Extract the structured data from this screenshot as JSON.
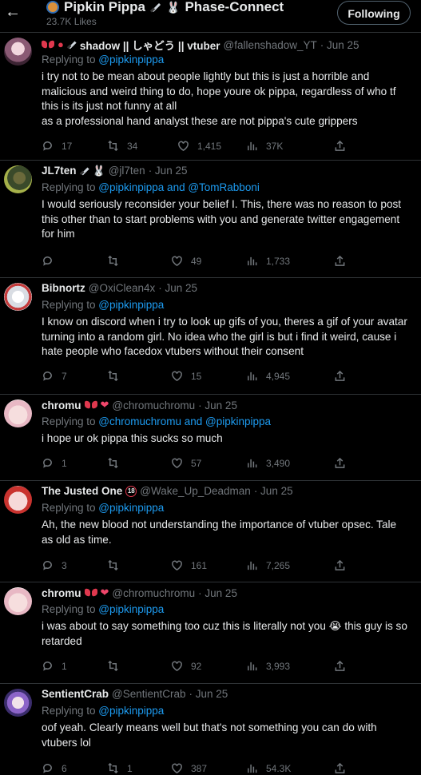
{
  "header": {
    "title": "Pipkin Pippa",
    "title_suffix": "Phase-Connect",
    "likes": "23.7K Likes",
    "follow_label": "Following"
  },
  "tweets": [
    {
      "name": "shadow || しゃどう || vtuber",
      "handle": "@fallenshadow_YT",
      "date": "· Jun 25",
      "reply_prefix": "Replying to ",
      "reply_to": "@pipkinpippa",
      "text": "i try not to be mean about people lightly but this is just a horrible and malicious and weird thing to do, hope youre ok pippa, regardless of who tf this is its just not funny at all\nas a professional hand analyst these are not pippa's cute grippers",
      "replies": "17",
      "retweets": "34",
      "likes": "1,415",
      "views": "37K"
    },
    {
      "name": "JL7ten",
      "handle": "@jl7ten",
      "date": "· Jun 25",
      "reply_prefix": "Replying to ",
      "reply_to": "@pipkinpippa and @TomRabboni",
      "text": "I would seriously reconsider your belief I. This, there was no reason to post this other than to start problems with you and generate twitter engagement for him",
      "replies": "",
      "retweets": "",
      "likes": "49",
      "views": "1,733"
    },
    {
      "name": "Bibnortz",
      "handle": "@OxiClean4x",
      "date": "· Jun 25",
      "reply_prefix": "Replying to ",
      "reply_to": "@pipkinpippa",
      "text": "I know on discord when i try to look up gifs of you, theres a gif of your avatar turning into a random girl. No idea who the girl is but i find it weird, cause i hate people who facedox vtubers without their consent",
      "replies": "7",
      "retweets": "",
      "likes": "15",
      "views": "4,945"
    },
    {
      "name": "chromu",
      "handle": "@chromuchromu",
      "date": "· Jun 25",
      "reply_prefix": "Replying to ",
      "reply_to": "@chromuchromu and @pipkinpippa",
      "text": "i hope ur ok pippa this sucks so much",
      "replies": "1",
      "retweets": "",
      "likes": "57",
      "views": "3,490"
    },
    {
      "name": "The Justed One",
      "handle": "@Wake_Up_Deadman",
      "date": "· Jun 25",
      "reply_prefix": "Replying to ",
      "reply_to": "@pipkinpippa",
      "text": "Ah, the new blood not understanding the importance of vtuber opsec. Tale as old as time.",
      "replies": "3",
      "retweets": "",
      "likes": "161",
      "views": "7,265"
    },
    {
      "name": "chromu",
      "handle": "@chromuchromu",
      "date": "· Jun 25",
      "reply_prefix": "Replying to ",
      "reply_to": "@pipkinpippa",
      "text": "i was about to say something too cuz this is literally not you 😭 this guy is so retarded",
      "replies": "1",
      "retweets": "",
      "likes": "92",
      "views": "3,993"
    },
    {
      "name": "SentientCrab",
      "handle": "@SentientCrab",
      "date": "· Jun 25",
      "reply_prefix": "Replying to ",
      "reply_to": "@pipkinpippa",
      "text": "oof yeah. Clearly means well but that's not something you can do with vtubers lol",
      "replies": "6",
      "retweets": "1",
      "likes": "387",
      "views": "54.3K"
    }
  ],
  "icons": {
    "back": "back-arrow-icon",
    "reply": "reply-icon",
    "retweet": "retweet-icon",
    "like": "heart-icon",
    "views": "views-icon",
    "share": "share-icon"
  },
  "colors": {
    "background": "#000000",
    "text": "#e7e9ea",
    "muted": "#71767b",
    "accent": "#1d9bf0",
    "divider": "#2f3336"
  }
}
